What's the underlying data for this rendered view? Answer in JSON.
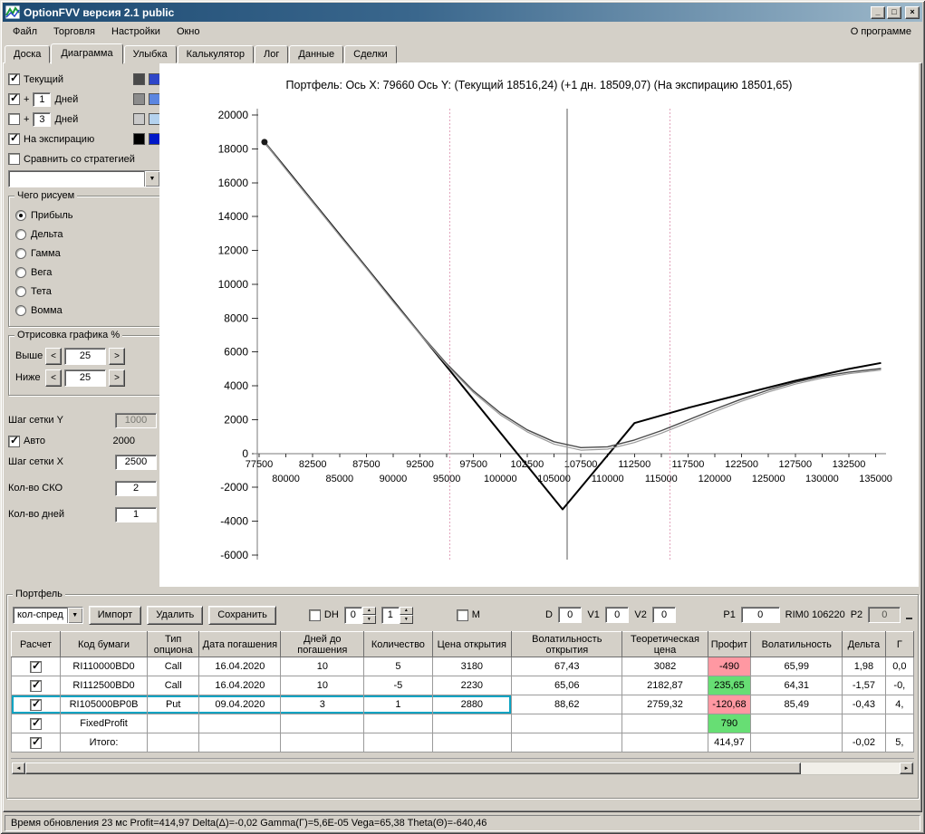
{
  "window": {
    "title": "OptionFVV версия 2.1 public",
    "buttons": {
      "minimize": "_",
      "maximize": "□",
      "close": "×"
    }
  },
  "menu": {
    "items": [
      "Файл",
      "Торговля",
      "Настройки",
      "Окно"
    ],
    "right": "О программе"
  },
  "tabs": [
    {
      "label": "Доска",
      "active": false
    },
    {
      "label": "Диаграмма",
      "active": true
    },
    {
      "label": "Улыбка",
      "active": false
    },
    {
      "label": "Калькулятор",
      "active": false
    },
    {
      "label": "Лог",
      "active": false
    },
    {
      "label": "Данные",
      "active": false
    },
    {
      "label": "Сделки",
      "active": false
    }
  ],
  "left_panel": {
    "curve_rows": [
      {
        "checked": true,
        "label": "Текущий",
        "sw1": "#4a4a4a",
        "sw2": "#2e46c8"
      },
      {
        "checked": true,
        "plus": "+",
        "days": "1",
        "label": "Дней",
        "sw1": "#8c8c8c",
        "sw2": "#5c86e0"
      },
      {
        "checked": false,
        "plus": "+",
        "days": "3",
        "label": "Дней",
        "sw1": "#c9c9c9",
        "sw2": "#b4d2ee"
      },
      {
        "checked": true,
        "label": "На экспирацию",
        "sw1": "#000000",
        "sw2": "#0018c8"
      }
    ],
    "compare": {
      "checked": false,
      "label": "Сравнить со стратегией"
    },
    "strategy_combo": {
      "value": ""
    },
    "draw_group": {
      "title": "Чего рисуем",
      "selected": 0,
      "options": [
        "Прибыль",
        "Дельта",
        "Гамма",
        "Вега",
        "Тета",
        "Вомма"
      ]
    },
    "render_group": {
      "title": "Отрисовка графика %",
      "dec": "<",
      "inc": ">",
      "rows": [
        {
          "label": "Выше",
          "value": "25"
        },
        {
          "label": "Ниже",
          "value": "25"
        }
      ]
    },
    "grid_y": {
      "label": "Шаг сетки Y",
      "value": "1000"
    },
    "auto": {
      "checked": true,
      "label": "Авто",
      "value": "2000"
    },
    "grid_x": {
      "label": "Шаг сетки X",
      "value": "2500"
    },
    "sko": {
      "label": "Кол-во СКО",
      "value": "2"
    },
    "days": {
      "label": "Кол-во дней",
      "value": "1"
    }
  },
  "chart_data": {
    "type": "line",
    "title": "Портфель: Ось X: 79660 Ось Y:  (Текущий 18516,24)  (+1 дн. 18509,07)  (На экспирацию 18501,65)",
    "x_axis": {
      "min": 77500,
      "max": 135500,
      "ticks_row1": [
        77500,
        82500,
        87500,
        92500,
        97500,
        102500,
        107500,
        112500,
        117500,
        122500,
        127500,
        132500
      ],
      "ticks_row2": [
        80000,
        85000,
        90000,
        95000,
        100000,
        105000,
        110000,
        115000,
        120000,
        125000,
        130000,
        135000
      ]
    },
    "y_axis": {
      "min": -6000,
      "max": 20000,
      "step": 2000,
      "ticks": [
        20000,
        18000,
        16000,
        14000,
        12000,
        10000,
        8000,
        6000,
        4000,
        2000,
        0,
        -2000,
        -4000,
        -6000
      ]
    },
    "vlines": [
      {
        "name": "current-price-line",
        "x": 106220,
        "color": "#5a5a5a",
        "dashed": false
      },
      {
        "name": "sko-lower-line",
        "x": 95300,
        "color": "#e2a4bc",
        "dashed": true
      },
      {
        "name": "sko-upper-line",
        "x": 115800,
        "color": "#e2a4bc",
        "dashed": true
      }
    ],
    "start_marker": {
      "x": 78000,
      "y": 18400
    },
    "series": [
      {
        "id": "expiration",
        "name": "На экспирацию",
        "color": "#000000",
        "width": 2,
        "points": [
          [
            78000,
            18400
          ],
          [
            105800,
            -3300
          ],
          [
            112500,
            1800
          ],
          [
            117500,
            2700
          ],
          [
            122500,
            3500
          ],
          [
            127500,
            4300
          ],
          [
            132500,
            5000
          ],
          [
            135500,
            5350
          ]
        ]
      },
      {
        "id": "current",
        "name": "Текущий",
        "color": "#4a4a4a",
        "width": 1.4,
        "points": [
          [
            78000,
            18400
          ],
          [
            80000,
            16800
          ],
          [
            82500,
            14850
          ],
          [
            85000,
            12900
          ],
          [
            87500,
            10970
          ],
          [
            90000,
            9000
          ],
          [
            92500,
            7100
          ],
          [
            95000,
            5300
          ],
          [
            97500,
            3700
          ],
          [
            100000,
            2400
          ],
          [
            102500,
            1400
          ],
          [
            105000,
            700
          ],
          [
            107500,
            350
          ],
          [
            110000,
            400
          ],
          [
            112500,
            800
          ],
          [
            115000,
            1350
          ],
          [
            117500,
            1980
          ],
          [
            120000,
            2620
          ],
          [
            122500,
            3220
          ],
          [
            125000,
            3760
          ],
          [
            127500,
            4210
          ],
          [
            130000,
            4560
          ],
          [
            132500,
            4810
          ],
          [
            135500,
            5020
          ]
        ]
      },
      {
        "id": "plus1day",
        "name": "+1 дн.",
        "color": "#9a9a9a",
        "width": 1.2,
        "points": [
          [
            78000,
            18400
          ],
          [
            80000,
            16790
          ],
          [
            82500,
            14860
          ],
          [
            85000,
            12880
          ],
          [
            87500,
            10940
          ],
          [
            90000,
            8960
          ],
          [
            92500,
            7050
          ],
          [
            95000,
            5230
          ],
          [
            97500,
            3600
          ],
          [
            100000,
            2280
          ],
          [
            102500,
            1280
          ],
          [
            105000,
            560
          ],
          [
            107500,
            200
          ],
          [
            110000,
            260
          ],
          [
            112500,
            650
          ],
          [
            115000,
            1200
          ],
          [
            117500,
            1830
          ],
          [
            120000,
            2480
          ],
          [
            122500,
            3090
          ],
          [
            125000,
            3640
          ],
          [
            127500,
            4100
          ],
          [
            130000,
            4460
          ],
          [
            132500,
            4720
          ],
          [
            135500,
            4930
          ]
        ]
      }
    ]
  },
  "portfolio": {
    "group_title": "Портфель",
    "toolbar": {
      "preset": "кол-спред",
      "buttons": [
        "Импорт",
        "Удалить",
        "Сохранить"
      ],
      "dh": {
        "checked": false,
        "label": "DH",
        "spin1": "0",
        "spin2": "1"
      },
      "m": {
        "checked": false,
        "label": "M"
      },
      "d": {
        "label": "D",
        "value": "0"
      },
      "v1": {
        "label": "V1",
        "value": "0"
      },
      "v2": {
        "label": "V2",
        "value": "0"
      },
      "p1": {
        "label": "P1",
        "value": "0"
      },
      "instrument": "RIM0 106220",
      "p2": {
        "label": "P2",
        "value": "0"
      }
    },
    "table": {
      "headers": [
        "Расчет",
        "Код бумаги",
        "Тип опциона",
        "Дата погашения",
        "Дней до погашения",
        "Количество",
        "Цена открытия",
        "Волатильность открытия",
        "Теоретическая цена",
        "Профит",
        "Волатильность",
        "Дельта",
        "Г"
      ],
      "rows": [
        {
          "checked": true,
          "selected": false,
          "profit_state": "neg",
          "cells": [
            "RI110000BD0",
            "Call",
            "16.04.2020",
            "10",
            "5",
            "3180",
            "67,43",
            "3082",
            "-490",
            "65,99",
            "1,98",
            "0,0"
          ]
        },
        {
          "checked": true,
          "selected": false,
          "profit_state": "pos",
          "cells": [
            "RI112500BD0",
            "Call",
            "16.04.2020",
            "10",
            "-5",
            "2230",
            "65,06",
            "2182,87",
            "235,65",
            "64,31",
            "-1,57",
            "-0,"
          ]
        },
        {
          "checked": true,
          "selected": true,
          "profit_state": "neg",
          "cells": [
            "RI105000BP0B",
            "Put",
            "09.04.2020",
            "3",
            "1",
            "2880",
            "88,62",
            "2759,32",
            "-120,68",
            "85,49",
            "-0,43",
            "4,"
          ]
        },
        {
          "checked": true,
          "selected": false,
          "profit_state": "pos",
          "cells": [
            "FixedProfit",
            "",
            "",
            "",
            "",
            "",
            "",
            "",
            "790",
            "",
            "",
            ""
          ]
        },
        {
          "checked": true,
          "selected": false,
          "profit_state": "none",
          "cells": [
            "Итого:",
            "",
            "",
            "",
            "",
            "",
            "",
            "",
            "414,97",
            "",
            "-0,02",
            "5,"
          ]
        }
      ]
    }
  },
  "icons": {
    "dropdown": "▼",
    "spin_up": "▲",
    "spin_down": "▼",
    "scroll_left": "◄",
    "scroll_right": "►"
  },
  "status": {
    "text": "Время обновления 23 мс  Profit=414,97 Delta(Δ)=-0,02 Gamma(Γ)=5,6E-05 Vega=65,38 Theta(Θ)=-640,46"
  }
}
